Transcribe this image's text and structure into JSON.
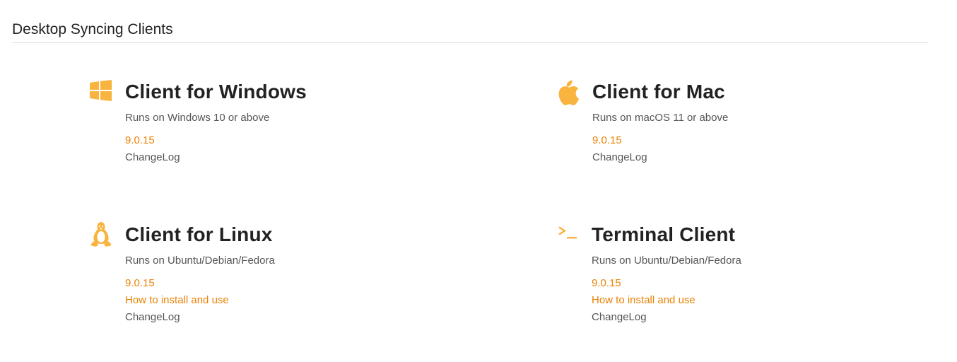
{
  "section": {
    "title": "Desktop Syncing Clients"
  },
  "accent_color": "#eb8205",
  "icon_color": "#f9b33f",
  "clients": [
    {
      "icon": "windows-icon",
      "title": "Client for Windows",
      "requirement": "Runs on Windows 10 or above",
      "version": "9.0.15",
      "changelog": "ChangeLog"
    },
    {
      "icon": "apple-icon",
      "title": "Client for Mac",
      "requirement": "Runs on macOS 11 or above",
      "version": "9.0.15",
      "changelog": "ChangeLog"
    },
    {
      "icon": "linux-icon",
      "title": "Client for Linux",
      "requirement": "Runs on Ubuntu/Debian/Fedora",
      "version": "9.0.15",
      "howto": "How to install and use",
      "changelog": "ChangeLog"
    },
    {
      "icon": "terminal-icon",
      "title": "Terminal Client",
      "requirement": "Runs on Ubuntu/Debian/Fedora",
      "version": "9.0.15",
      "howto": "How to install and use",
      "changelog": "ChangeLog"
    }
  ]
}
